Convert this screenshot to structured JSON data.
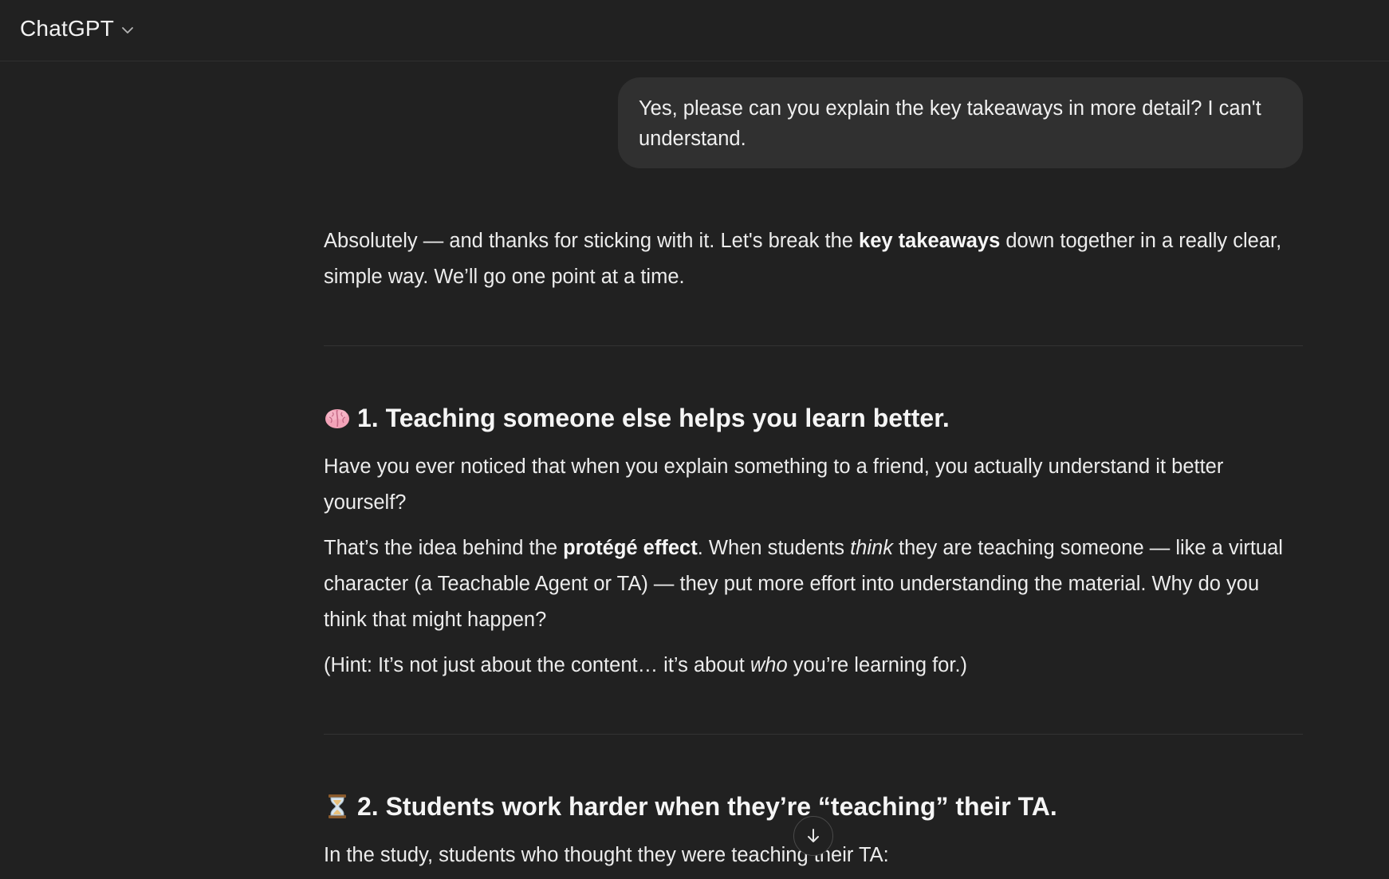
{
  "header": {
    "model_name": "ChatGPT"
  },
  "user_message": {
    "text": "Yes, please can you explain the key takeaways in more detail? I can't understand."
  },
  "assistant": {
    "intro": {
      "before_bold": "Absolutely — and thanks for sticking with it. Let's break the ",
      "bold": "key takeaways",
      "after_bold": " down together in a really clear, simple way. We’ll go one point at a time."
    },
    "section1": {
      "icon": "brain-emoji",
      "title": "1. Teaching someone else helps you learn better.",
      "p1": "Have you ever noticed that when you explain something to a friend, you actually understand it better yourself?",
      "p2": {
        "a": "That’s the idea behind the ",
        "bold": "protégé effect",
        "b": ". When students ",
        "italic": "think",
        "c": " they are teaching someone — like a virtual character (a Teachable Agent or TA) — they put more effort into understanding the material. Why do you think that might happen?"
      },
      "p3": {
        "a": "(Hint: It’s not just about the content… it’s about ",
        "italic": "who",
        "b": " you’re learning for.)"
      }
    },
    "section2": {
      "icon": "hourglass-emoji",
      "title": "2. Students work harder when they’re “teaching” their TA.",
      "p1": "In the study, students who thought they were teaching their TA:"
    }
  },
  "controls": {
    "scroll_down_icon": "arrow-down-icon"
  }
}
